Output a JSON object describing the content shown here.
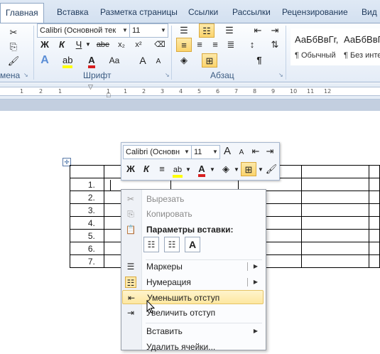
{
  "tabs": [
    "Главная",
    "Вставка",
    "Разметка страницы",
    "Ссылки",
    "Рассылки",
    "Рецензирование",
    "Вид"
  ],
  "ribbon": {
    "font_name": "Calibri (Основной тек",
    "font_size": "11",
    "group_clipboard": "мена",
    "group_font": "Шрифт",
    "group_paragraph": "Абзац",
    "bold": "Ж",
    "italic": "К",
    "underline": "Ч",
    "strike": "abe",
    "sub": "x₂",
    "sup": "x²",
    "font_color": "A",
    "case": "Aa",
    "grow": "A",
    "shrink": "A",
    "pilcrow": "¶",
    "styles": [
      {
        "preview": "АаБбВвГг,",
        "name": "¶ Обычный"
      },
      {
        "preview": "АаБбВвГг",
        "name": "¶ Без инте"
      }
    ]
  },
  "ruler_ticks": [
    "1",
    "2",
    "1",
    "1",
    "1",
    "2",
    "3",
    "4",
    "5",
    "6",
    "7",
    "8",
    "9",
    "10",
    "11",
    "12"
  ],
  "table_rows": [
    "1.",
    "2.",
    "3.",
    "4.",
    "5.",
    "6.",
    "7."
  ],
  "mini_toolbar": {
    "font_name": "Calibri (Основн",
    "font_size": "11",
    "bold": "Ж",
    "italic": "К",
    "align": "≡",
    "font_color": "A"
  },
  "menu": {
    "cut": "Вырезать",
    "copy": "Копировать",
    "paste_header": "Параметры вставки:",
    "paste_text_glyph": "A",
    "bullets": "Маркеры",
    "numbering": "Нумерация",
    "decrease_indent": "Уменьшить отступ",
    "increase_indent": "Увеличить отступ",
    "insert": "Вставить",
    "delete_cells": "Удалить ячейки..."
  },
  "colors": {
    "highlight": "#fbd46c",
    "font_red": "#d81e1e",
    "highlight_yellow": "#ffff00",
    "ribbon_label": "#3c5c82"
  }
}
